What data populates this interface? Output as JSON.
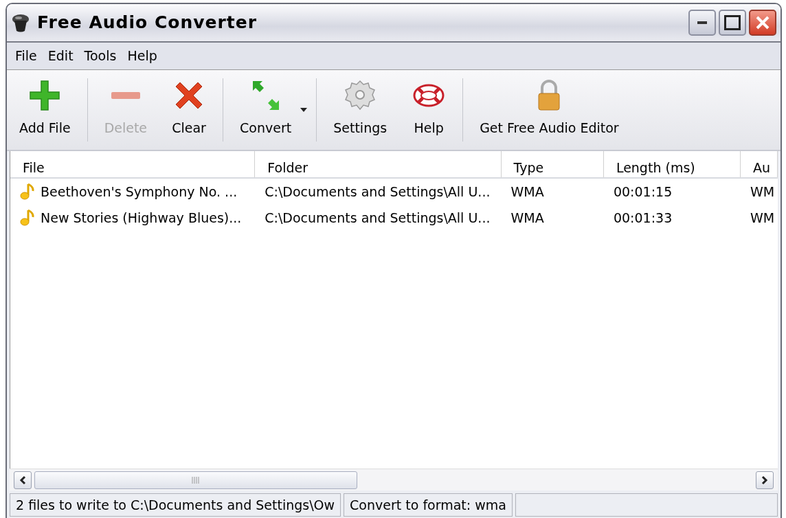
{
  "window": {
    "title": "Free Audio Converter"
  },
  "menu": [
    "File",
    "Edit",
    "Tools",
    "Help"
  ],
  "toolbar": [
    [
      {
        "label": "Add File",
        "kind": "add",
        "disabled": false,
        "dropdown": false
      }
    ],
    [
      {
        "label": "Delete",
        "kind": "delete",
        "disabled": true,
        "dropdown": false
      },
      {
        "label": "Clear",
        "kind": "clear",
        "disabled": false,
        "dropdown": false
      }
    ],
    [
      {
        "label": "Convert",
        "kind": "convert",
        "disabled": false,
        "dropdown": true
      }
    ],
    [
      {
        "label": "Settings",
        "kind": "settings",
        "disabled": false,
        "dropdown": false
      },
      {
        "label": "Help",
        "kind": "help",
        "disabled": false,
        "dropdown": false
      }
    ],
    [
      {
        "label": "Get Free Audio Editor",
        "kind": "lock",
        "disabled": false,
        "dropdown": false
      }
    ]
  ],
  "table": {
    "columns": [
      "File",
      "Folder",
      "Type",
      "Length (ms)",
      "Au"
    ],
    "rows": [
      [
        "Beethoven's Symphony No. ...",
        "C:\\Documents and Settings\\All U...",
        "WMA",
        "00:01:15",
        "WM"
      ],
      [
        "New Stories (Highway Blues)...",
        "C:\\Documents and Settings\\All U...",
        "WMA",
        "00:01:33",
        "WM"
      ]
    ]
  },
  "status_bar": [
    "2 files to write to C:\\Documents and Settings\\Ow",
    "Convert to format: wma"
  ]
}
